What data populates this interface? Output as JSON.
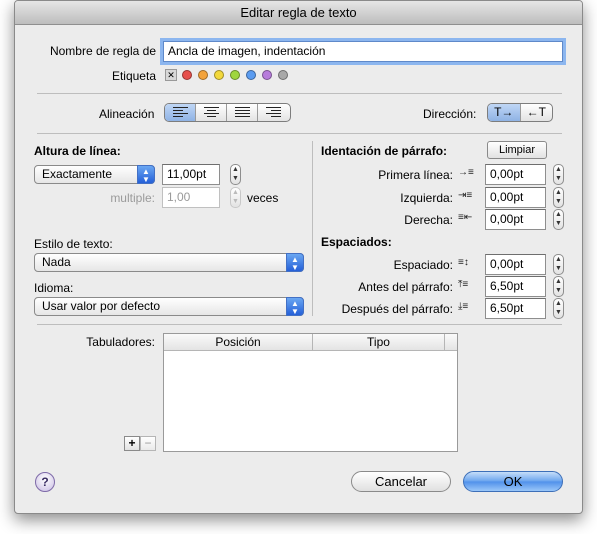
{
  "window": {
    "title": "Editar regla de texto"
  },
  "rule_name": {
    "label": "Nombre de regla de",
    "value": "Ancla de imagen, indentación"
  },
  "tag": {
    "label": "Etiqueta",
    "none_symbol": "✕",
    "colors": [
      "#e6504c",
      "#f3a33b",
      "#f2d83c",
      "#9fd63f",
      "#5b9cf0",
      "#b77ddb",
      "#a8a8a8"
    ]
  },
  "alignment": {
    "label": "Alineación",
    "selected_index": 0,
    "options": [
      "align-left-icon",
      "align-center-icon",
      "align-justify-icon",
      "align-right-icon"
    ]
  },
  "direction": {
    "label": "Dirección:",
    "ltr": "T→",
    "rtl": "←T"
  },
  "line_height": {
    "heading": "Altura de línea:",
    "mode": "Exactamente",
    "value": "11,00pt",
    "multiple_label": "multiple:",
    "multiple_value": "1,00",
    "multiple_unit": "veces"
  },
  "text_style": {
    "label": "Estilo de texto:",
    "value": "Nada"
  },
  "language": {
    "label": "Idioma:",
    "value": "Usar valor por defecto"
  },
  "indent": {
    "heading": "Identación de párrafo:",
    "clear_button": "Limpiar",
    "first_line_label": "Primera línea:",
    "first_line_value": "0,00pt",
    "left_label": "Izquierda:",
    "left_value": "0,00pt",
    "right_label": "Derecha:",
    "right_value": "0,00pt"
  },
  "spacing": {
    "heading": "Espaciados:",
    "spacing_label": "Espaciado:",
    "spacing_value": "0,00pt",
    "before_label": "Antes del párrafo:",
    "before_value": "6,50pt",
    "after_label": "Después del párrafo:",
    "after_value": "6,50pt"
  },
  "tabs": {
    "label": "Tabuladores:",
    "columns": [
      "Posición",
      "Tipo"
    ],
    "add": "+",
    "remove": "−"
  },
  "footer": {
    "help": "?",
    "cancel": "Cancelar",
    "ok": "OK"
  }
}
